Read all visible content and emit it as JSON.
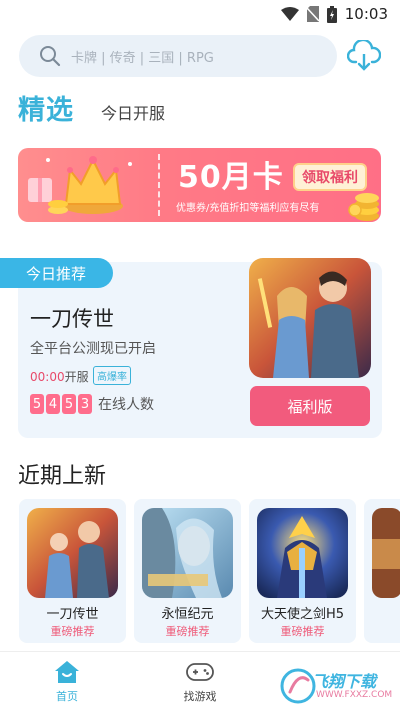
{
  "status_bar": {
    "time": "10:03"
  },
  "search": {
    "placeholder": "卡牌 | 传奇 | 三国 | RPG"
  },
  "tabs": {
    "selected": "精选",
    "other": "今日开服"
  },
  "banner": {
    "headline": "50月卡",
    "claim_button": "领取福利",
    "subtext": "优惠券/充值折扣等福利应有尽有"
  },
  "today_recommend": {
    "badge": "今日推荐",
    "title": "一刀传世",
    "description": "全平台公测现已开启",
    "open_time": "00:00",
    "open_suffix": "开服",
    "tag": "高爆率",
    "online_digits": [
      "5",
      "4",
      "5",
      "3"
    ],
    "online_label": "在线人数",
    "button": "福利版"
  },
  "recent": {
    "title": "近期上新",
    "games": [
      {
        "name": "一刀传世",
        "tag": "重磅推荐"
      },
      {
        "name": "永恒纪元",
        "tag": "重磅推荐"
      },
      {
        "name": "大天使之剑H5",
        "tag": "重磅推荐"
      }
    ]
  },
  "bottom_nav": {
    "home": "首页",
    "find": "找游戏"
  },
  "watermark": {
    "text": "飞翔下载",
    "url": "WWW.FXXZ.COM"
  },
  "colors": {
    "accent": "#3ab2d9",
    "pink": "#f25b7d",
    "card_bg": "#eef5fc"
  }
}
